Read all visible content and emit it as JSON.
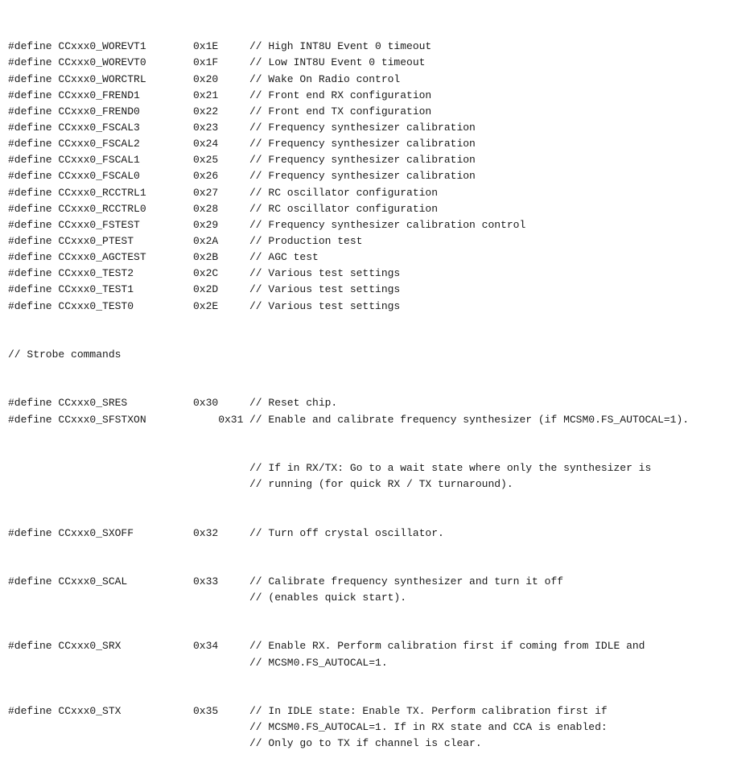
{
  "lines": [
    {
      "define": "#define CCxxx0_WOREVT1",
      "value": "0x1E",
      "comment": "// High INT8U Event 0 timeout"
    },
    {
      "define": "#define CCxxx0_WOREVT0",
      "value": "0x1F",
      "comment": "// Low INT8U Event 0 timeout"
    },
    {
      "define": "#define CCxxx0_WORCTRL",
      "value": "0x20",
      "comment": "// Wake On Radio control"
    },
    {
      "define": "#define CCxxx0_FREND1",
      "value": "0x21",
      "comment": "// Front end RX configuration"
    },
    {
      "define": "#define CCxxx0_FREND0",
      "value": "0x22",
      "comment": "// Front end TX configuration"
    },
    {
      "define": "#define CCxxx0_FSCAL3",
      "value": "0x23",
      "comment": "// Frequency synthesizer calibration"
    },
    {
      "define": "#define CCxxx0_FSCAL2",
      "value": "0x24",
      "comment": "// Frequency synthesizer calibration"
    },
    {
      "define": "#define CCxxx0_FSCAL1",
      "value": "0x25",
      "comment": "// Frequency synthesizer calibration"
    },
    {
      "define": "#define CCxxx0_FSCAL0",
      "value": "0x26",
      "comment": "// Frequency synthesizer calibration"
    },
    {
      "define": "#define CCxxx0_RCCTRL1",
      "value": "0x27",
      "comment": "// RC oscillator configuration"
    },
    {
      "define": "#define CCxxx0_RCCTRL0",
      "value": "0x28",
      "comment": "// RC oscillator configuration"
    },
    {
      "define": "#define CCxxx0_FSTEST",
      "value": "0x29",
      "comment": "// Frequency synthesizer calibration control"
    },
    {
      "define": "#define CCxxx0_PTEST",
      "value": "0x2A",
      "comment": "// Production test"
    },
    {
      "define": "#define CCxxx0_AGCTEST",
      "value": "0x2B",
      "comment": "// AGC test"
    },
    {
      "define": "#define CCxxx0_TEST2",
      "value": "0x2C",
      "comment": "// Various test settings"
    },
    {
      "define": "#define CCxxx0_TEST1",
      "value": "0x2D",
      "comment": "// Various test settings"
    },
    {
      "define": "#define CCxxx0_TEST0",
      "value": "0x2E",
      "comment": "// Various test settings"
    }
  ],
  "strobe_header": "// Strobe commands",
  "strobe_lines": [
    {
      "define": "#define CCxxx0_SRES",
      "value": "0x30",
      "comment": "// Reset chip."
    },
    {
      "define": "#define CCxxx0_SFSTXON",
      "value": "    0x31",
      "comment": "// Enable and calibrate frequency synthesizer (if MCSM0.FS_AUTOCAL=1)."
    }
  ],
  "sfstxon_cont": [
    "// If in RX/TX: Go to a wait state where only the synthesizer is",
    "// running (for quick RX / TX turnaround)."
  ],
  "sxoff": {
    "define": "#define CCxxx0_SXOFF",
    "value": "0x32",
    "comment": "// Turn off crystal oscillator."
  },
  "scal_lines": [
    {
      "define": "#define CCxxx0_SCAL",
      "value": "0x33",
      "comment": "// Calibrate frequency synthesizer and turn it off"
    },
    {
      "cont": "// (enables quick start)."
    }
  ],
  "srx_lines": [
    {
      "define": "#define CCxxx0_SRX",
      "value": "0x34",
      "comment": "// Enable RX. Perform calibration first if coming from IDLE and"
    },
    {
      "cont": "// MCSM0.FS_AUTOCAL=1."
    }
  ],
  "stx_lines": [
    {
      "define": "#define CCxxx0_STX",
      "value": "0x35",
      "comment": "// In IDLE state: Enable TX. Perform calibration first if"
    },
    {
      "cont": "// MCSM0.FS_AUTOCAL=1. If in RX state and CCA is enabled:"
    },
    {
      "cont": "// Only go to TX if channel is clear."
    }
  ]
}
